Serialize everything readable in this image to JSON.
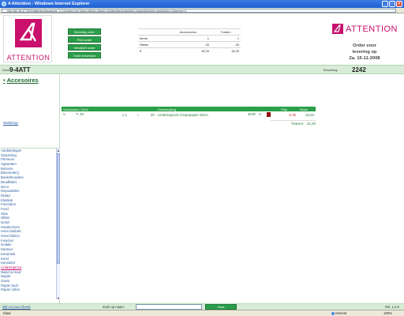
{
  "window": {
    "title": "4-Attention - Windows Internet Explorer",
    "url": "http://82.45.47.202/Hattention/javascript_1.2.0/online.php?lang=nl&tcb=4&sub=4&attention&nrdubble=nadubl&mitoeb=ranbide&d=1&banner=2"
  },
  "header": {
    "logo_text": "ATTENTION",
    "buttons": [
      "Bevestig order",
      "Print order",
      "Verwijder order",
      "Order bewerken"
    ],
    "summary": {
      "columns": [
        "",
        "Accessoires",
        "Totalen"
      ],
      "rows": [
        {
          "label": "Items",
          "accessoires": "1",
          "totalen": "1"
        },
        {
          "label": "Stelen",
          "accessoires": "20",
          "totalen": "20"
        },
        {
          "label": "€",
          "accessoires": "15,20",
          "totalen": "15,20"
        }
      ]
    },
    "brand_text": "ATTENTION",
    "order_info": {
      "line1": "Order voor",
      "line2": "levering op",
      "line3": "Za. 15-11-2008"
    }
  },
  "greenbar": {
    "klant_label": "Klant:",
    "klant_value": "9-4ATT",
    "bestelling_label": "Bestelling:",
    "bestelling_value": "2242"
  },
  "sidebar": {
    "heading": "Accesoires",
    "bullet": "•",
    "webshop_link": "Webshop",
    "categories": [
      "Aanbiedingen",
      "Opruiming",
      "Primeurs",
      "Apparaten",
      "Bezems",
      "Bloemetterij",
      "Boekelhouders",
      "Bruidfabriv",
      "Deco",
      "Disposables",
      "Draad",
      "Elastiek",
      "Fotorollen",
      "Food",
      "Glas",
      "Glitter",
      "Grind",
      "Handschoen",
      "Hoes bedrukt",
      "Hoes blanco",
      "Insecten",
      "Isolatie",
      "Kantoor",
      "Keramiek",
      "Kerst",
      "Kunststof",
      "Lint&Organza",
      "Mand & Hout",
      "Napier",
      "Oasis",
      "Papier bedr",
      "Papier rollen"
    ],
    "active_category": "Lint&Organza"
  },
  "order_table": {
    "headers": [
      "Accesoires / 2242",
      "",
      "",
      "",
      "Omschrijving",
      "",
      "Prijs",
      "Totaal"
    ],
    "rows": [
      {
        "v": "V",
        "icon": "edit",
        "qty": "20",
        "mult": "x 1",
        "eq": "=",
        "total_qty": "20",
        "description": "Lint&Organza Crepepapier 50cm",
        "color": "BOR",
        "count": "0",
        "price": "0,76",
        "total": "15,20"
      }
    ],
    "total_label": "Totaal €",
    "total_value": "15,20"
  },
  "bottombar": {
    "account_link": "Mijn Account (best)",
    "search_label": "Zoek op naam:",
    "search_value": "",
    "search_button": "Zoek",
    "ref": "Rel. 1.2.0"
  },
  "statusbar": {
    "left": "Klaar",
    "zone": "Internet",
    "zoom": "100%"
  },
  "colors": {
    "brand": "#c8106c",
    "green": "#2a9e48",
    "light_green": "#d8ecd8"
  }
}
